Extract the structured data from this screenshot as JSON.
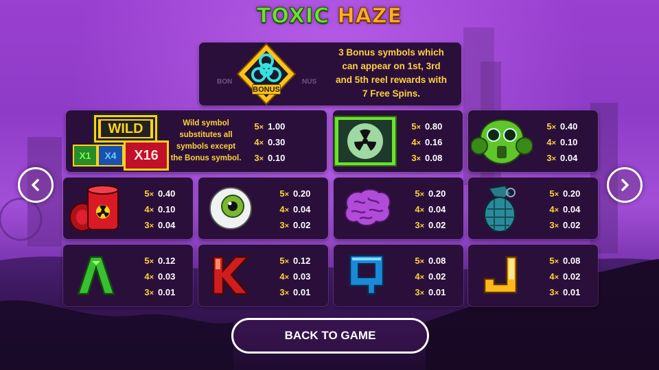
{
  "game": {
    "title_part1": "TOXIC",
    "title_part2": "HAZE"
  },
  "bonus": {
    "icon": "biohazard-bonus-icon",
    "badge": "BONUS",
    "side_text_left": "BON",
    "side_text_right": "NUS",
    "description_lines": [
      "3 Bonus symbols which",
      "can appear on 1st, 3rd",
      "and 5th reel rewards with",
      "7 Free Spins."
    ]
  },
  "wild": {
    "badge": "WILD",
    "multipliers": [
      "X1",
      "X4",
      "X16"
    ],
    "description_lines": [
      "Wild symbol",
      "substitutes all",
      "symbols except",
      "the Bonus symbol."
    ]
  },
  "paytable": [
    {
      "symbol": "wild",
      "icon": "wild-icon",
      "pays": [
        {
          "count": "5",
          "value": "1.00"
        },
        {
          "count": "4",
          "value": "0.30"
        },
        {
          "count": "3",
          "value": "0.10"
        }
      ]
    },
    {
      "symbol": "radiation",
      "icon": "radiation-icon",
      "pays": [
        {
          "count": "5",
          "value": "0.80"
        },
        {
          "count": "4",
          "value": "0.16"
        },
        {
          "count": "3",
          "value": "0.08"
        }
      ]
    },
    {
      "symbol": "gas-mask",
      "icon": "gas-mask-icon",
      "pays": [
        {
          "count": "5",
          "value": "0.40"
        },
        {
          "count": "4",
          "value": "0.10"
        },
        {
          "count": "3",
          "value": "0.04"
        }
      ]
    },
    {
      "symbol": "barrels",
      "icon": "toxic-barrels-icon",
      "pays": [
        {
          "count": "5",
          "value": "0.40"
        },
        {
          "count": "4",
          "value": "0.10"
        },
        {
          "count": "3",
          "value": "0.04"
        }
      ]
    },
    {
      "symbol": "eyeball",
      "icon": "eyeball-icon",
      "pays": [
        {
          "count": "5",
          "value": "0.20"
        },
        {
          "count": "4",
          "value": "0.04"
        },
        {
          "count": "3",
          "value": "0.02"
        }
      ]
    },
    {
      "symbol": "brain",
      "icon": "brain-icon",
      "pays": [
        {
          "count": "5",
          "value": "0.20"
        },
        {
          "count": "4",
          "value": "0.04"
        },
        {
          "count": "3",
          "value": "0.02"
        }
      ]
    },
    {
      "symbol": "grenade",
      "icon": "grenade-icon",
      "pays": [
        {
          "count": "5",
          "value": "0.20"
        },
        {
          "count": "4",
          "value": "0.04"
        },
        {
          "count": "3",
          "value": "0.02"
        }
      ]
    },
    {
      "symbol": "A",
      "icon": "letter-a-icon",
      "pays": [
        {
          "count": "5",
          "value": "0.12"
        },
        {
          "count": "4",
          "value": "0.03"
        },
        {
          "count": "3",
          "value": "0.01"
        }
      ]
    },
    {
      "symbol": "K",
      "icon": "letter-k-icon",
      "pays": [
        {
          "count": "5",
          "value": "0.12"
        },
        {
          "count": "4",
          "value": "0.03"
        },
        {
          "count": "3",
          "value": "0.01"
        }
      ]
    },
    {
      "symbol": "Q",
      "icon": "letter-q-icon",
      "pays": [
        {
          "count": "5",
          "value": "0.08"
        },
        {
          "count": "4",
          "value": "0.02"
        },
        {
          "count": "3",
          "value": "0.01"
        }
      ]
    },
    {
      "symbol": "J",
      "icon": "letter-j-icon",
      "pays": [
        {
          "count": "5",
          "value": "0.08"
        },
        {
          "count": "4",
          "value": "0.02"
        },
        {
          "count": "3",
          "value": "0.01"
        }
      ]
    }
  ],
  "multiplier_sign": "×",
  "navigation": {
    "prev_icon": "chevron-left-icon",
    "next_icon": "chevron-right-icon",
    "back_label": "BACK TO GAME"
  },
  "colors": {
    "panel": "#2b0f3b",
    "accent_yellow": "#ffd23a",
    "title_green": "#6fe030",
    "title_orange": "#ffb020"
  }
}
